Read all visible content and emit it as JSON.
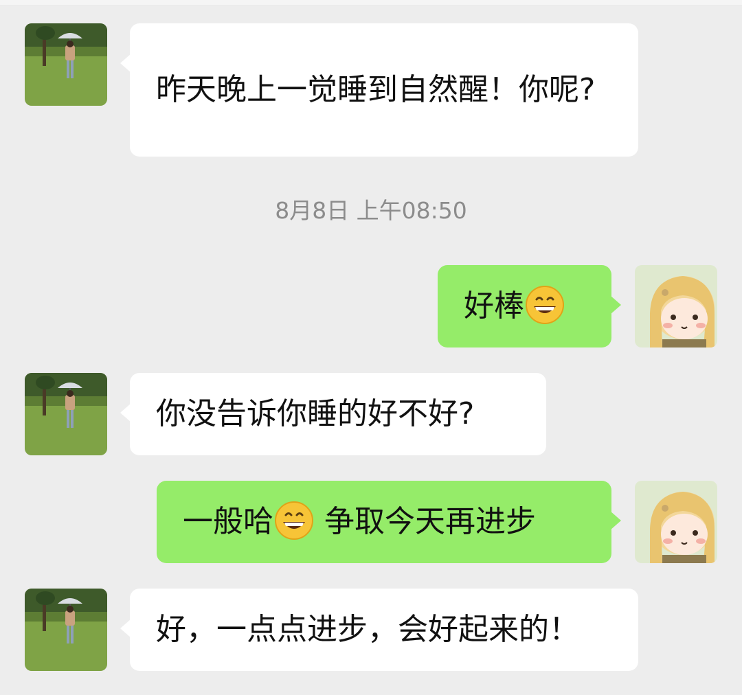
{
  "timestamp": "8月8日 上午08:50",
  "messages": [
    {
      "side": "in",
      "text": "昨天晚上一觉睡到自然醒！你呢?"
    },
    {
      "side": "out",
      "text_before": "好棒",
      "emoji": "grinning-emoji"
    },
    {
      "side": "in",
      "text": "你没告诉你睡的好不好?"
    },
    {
      "side": "out",
      "text_before": "一般哈",
      "emoji": "grinning-emoji",
      "text_after": " 争取今天再进步"
    },
    {
      "side": "in",
      "text": "好，一点点进步，会好起来的！"
    }
  ],
  "colors": {
    "background": "#ededed",
    "incoming_bubble": "#ffffff",
    "outgoing_bubble": "#95ec69",
    "timestamp": "#8c8c8c"
  }
}
